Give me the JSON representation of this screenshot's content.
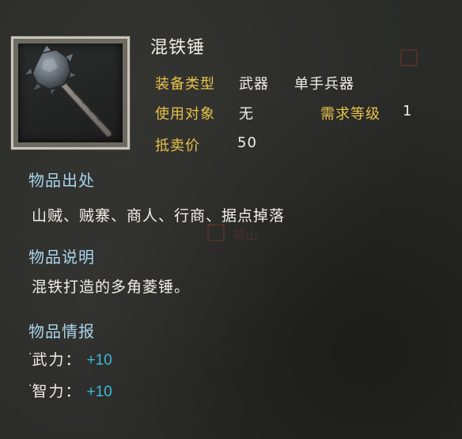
{
  "item": {
    "name": "混铁锤",
    "icon": "iron-mace-icon"
  },
  "attributes": {
    "equip_type_label": "装备类型",
    "equip_type_value": "武器",
    "equip_subtype_value": "单手兵器",
    "target_label": "使用对象",
    "target_value": "无",
    "level_label": "需求等级",
    "level_value": "1",
    "price_label": "抵卖价",
    "price_value": "50"
  },
  "source": {
    "title": "物品出处",
    "text": "山贼、贼寨、商人、行商、据点掉落"
  },
  "description": {
    "title": "物品说明",
    "text": "混铁打造的多角菱锤。"
  },
  "intel": {
    "title": "物品情报",
    "stats": [
      {
        "name": "武力",
        "value": "+10"
      },
      {
        "name": "智力",
        "value": "+10"
      }
    ]
  },
  "watermark": {
    "text": "祁山"
  },
  "colors": {
    "label_gold": "#e8c24a",
    "section_blue": "#a8d5ea",
    "stat_cyan": "#3fb7d8",
    "text_white": "#f2efe6",
    "background": "#2a2b28"
  }
}
